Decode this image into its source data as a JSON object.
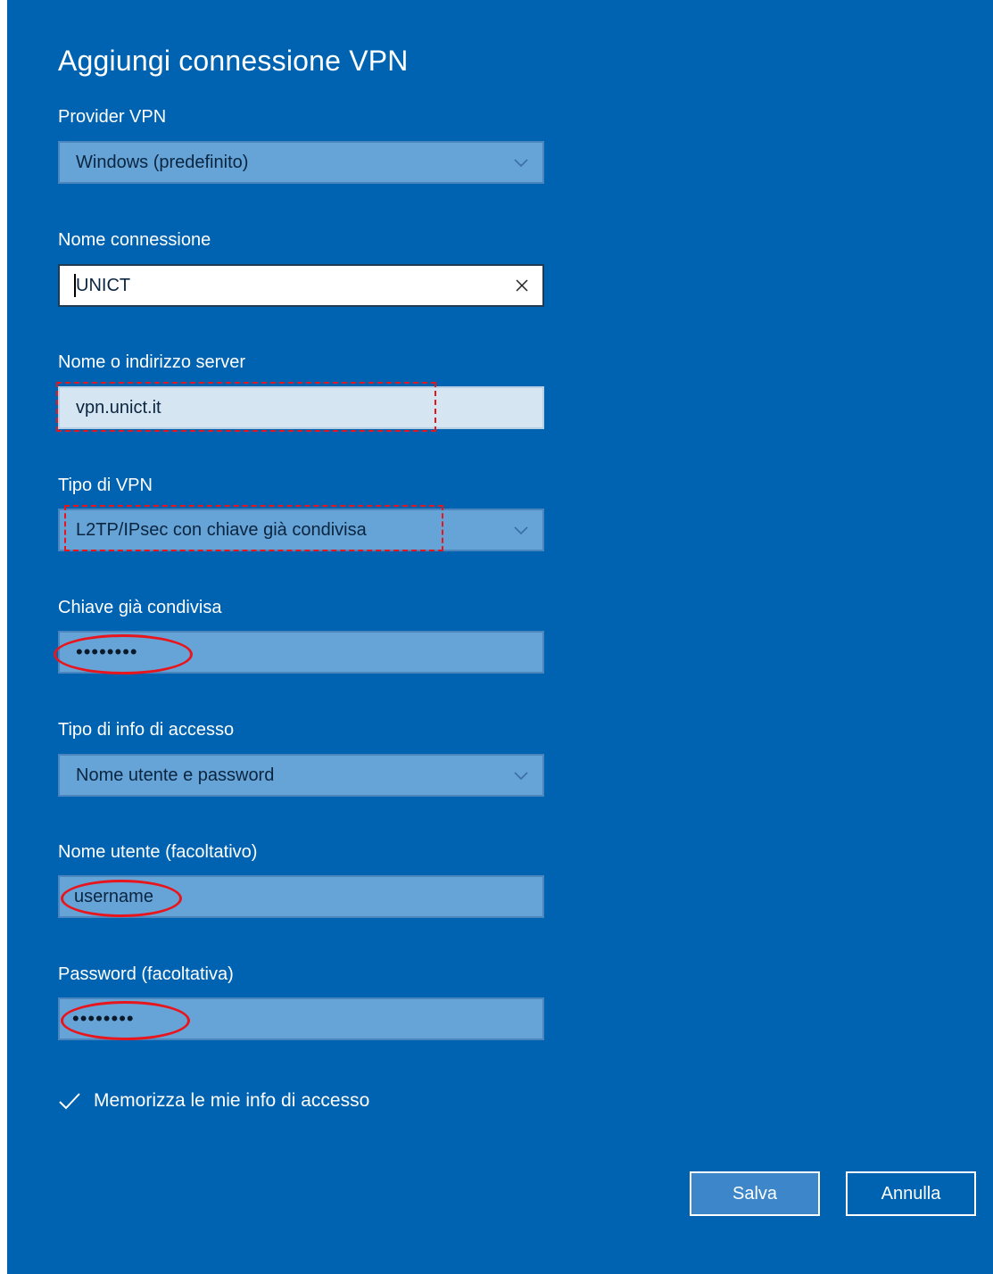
{
  "dialog": {
    "title": "Aggiungi connessione VPN"
  },
  "provider": {
    "label": "Provider VPN",
    "value": "Windows (predefinito)",
    "icon": "chevron-down-icon"
  },
  "connection_name": {
    "label": "Nome connessione",
    "value": "UNICT",
    "icon": "clear-x-icon"
  },
  "server": {
    "label": "Nome o indirizzo server",
    "value": "vpn.unict.it"
  },
  "vpn_type": {
    "label": "Tipo di VPN",
    "value": "L2TP/IPsec con chiave già condivisa",
    "icon": "chevron-down-icon"
  },
  "preshared_key": {
    "label": "Chiave già condivisa",
    "value": "••••••••"
  },
  "signin_type": {
    "label": "Tipo di info di accesso",
    "value": "Nome utente e password",
    "icon": "chevron-down-icon"
  },
  "username": {
    "label": "Nome utente (facoltativo)",
    "value": "username"
  },
  "password": {
    "label": "Password (facoltativa)",
    "value": "••••••••"
  },
  "remember": {
    "label": "Memorizza le mie info di accesso",
    "checked": true,
    "icon": "checkmark-icon"
  },
  "buttons": {
    "save": "Salva",
    "cancel": "Annulla"
  },
  "colors": {
    "background": "#0063b1",
    "field": "#66a3d6",
    "annotation": "#e8161c"
  }
}
